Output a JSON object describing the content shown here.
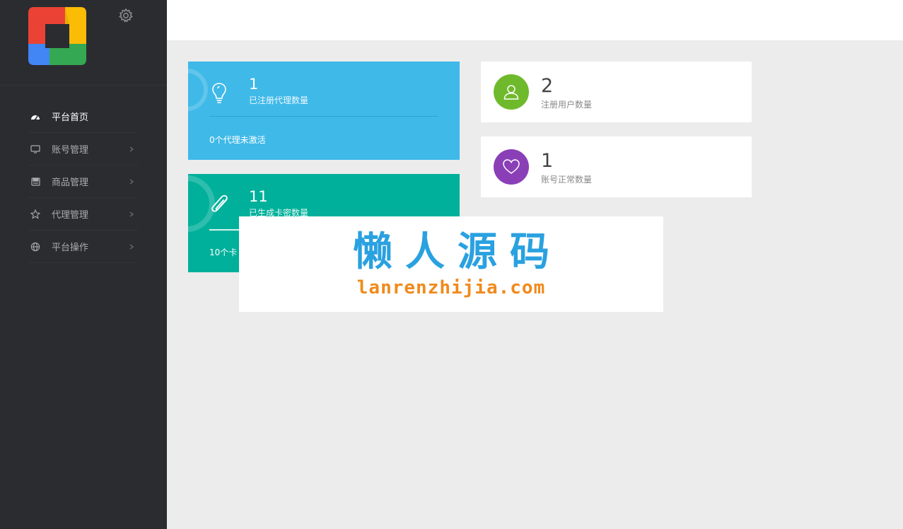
{
  "colors": {
    "sidebar_bg": "#2b2c30",
    "blue_card": "#3fb9e8",
    "teal_card": "#00b09b",
    "green_circle": "#6fba2c",
    "purple_circle": "#8a3fb7",
    "watermark_title": "#2aa1e0",
    "watermark_url": "#f08a1c"
  },
  "sidebar": {
    "logo_icon": "google-style-logo",
    "settings_icon": "gear-icon",
    "items": [
      {
        "label": "平台首页",
        "icon": "dashboard-icon",
        "active": true
      },
      {
        "label": "账号管理",
        "icon": "monitor-icon",
        "active": false
      },
      {
        "label": "商品管理",
        "icon": "disk-icon",
        "active": false
      },
      {
        "label": "代理管理",
        "icon": "star-icon",
        "active": false
      },
      {
        "label": "平台操作",
        "icon": "globe-icon",
        "active": false
      }
    ]
  },
  "cards": {
    "agents": {
      "value": "1",
      "label": "已注册代理数量",
      "footer": "0个代理未激活",
      "icon": "lightbulb-icon"
    },
    "cardkeys": {
      "value": "11",
      "label": "已生成卡密数量",
      "footer": "10个卡",
      "icon": "paperclip-icon"
    },
    "users": {
      "value": "2",
      "label": "注册用户数量",
      "icon": "user-icon"
    },
    "accounts": {
      "value": "1",
      "label": "账号正常数量",
      "icon": "heart-icon"
    }
  },
  "watermark": {
    "title": "懒人源码",
    "url": "lanrenzhijia.com"
  }
}
